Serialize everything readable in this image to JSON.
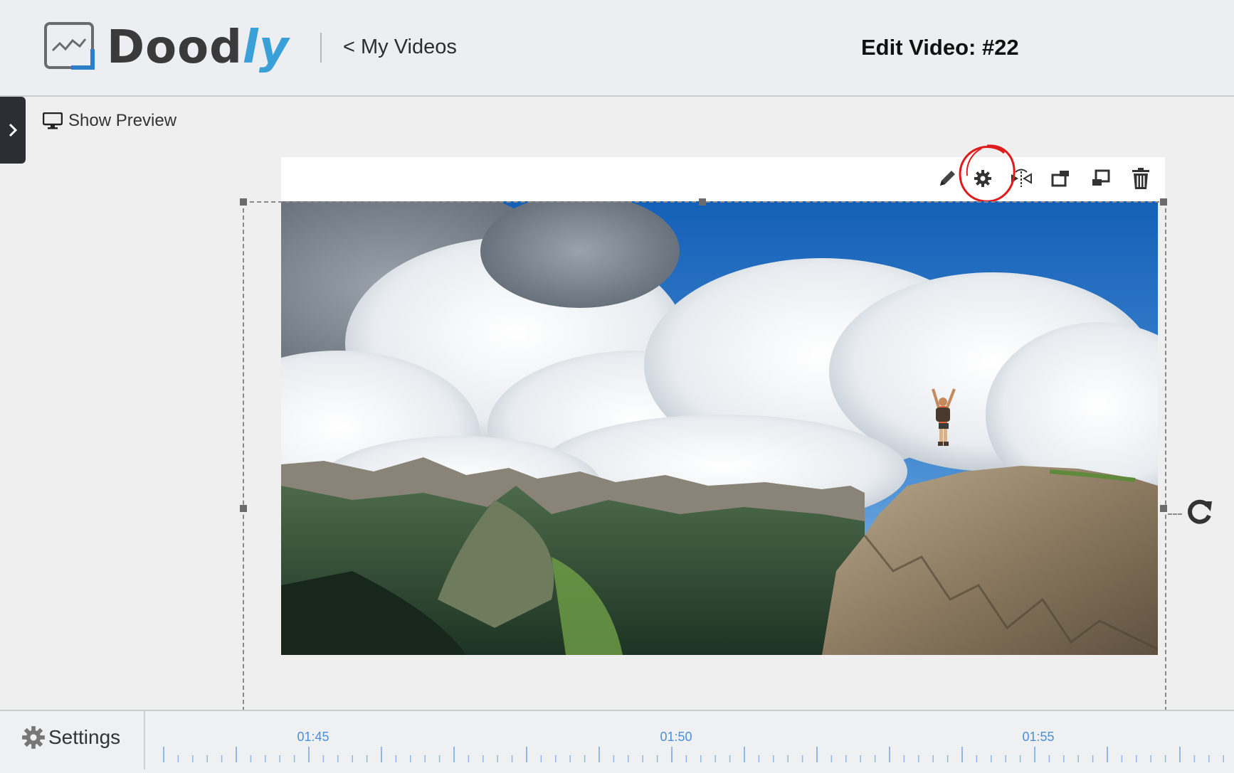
{
  "header": {
    "logo_text": "Doodly",
    "back_link": "< My Videos",
    "title": "Edit Video: #22"
  },
  "canvas": {
    "show_preview_label": "Show Preview",
    "toolbar_icons": [
      "pencil-icon",
      "gear-icon",
      "flip-icon",
      "bring-forward-icon",
      "send-backward-icon",
      "trash-icon"
    ],
    "highlight_color": "#e01b1b"
  },
  "bottom": {
    "settings_label": "Settings",
    "timeline_labels": [
      "01:45",
      "01:50",
      "01:55"
    ]
  },
  "colors": {
    "accent": "#4a8fd8",
    "logo_ly": "#3aa0d8"
  }
}
